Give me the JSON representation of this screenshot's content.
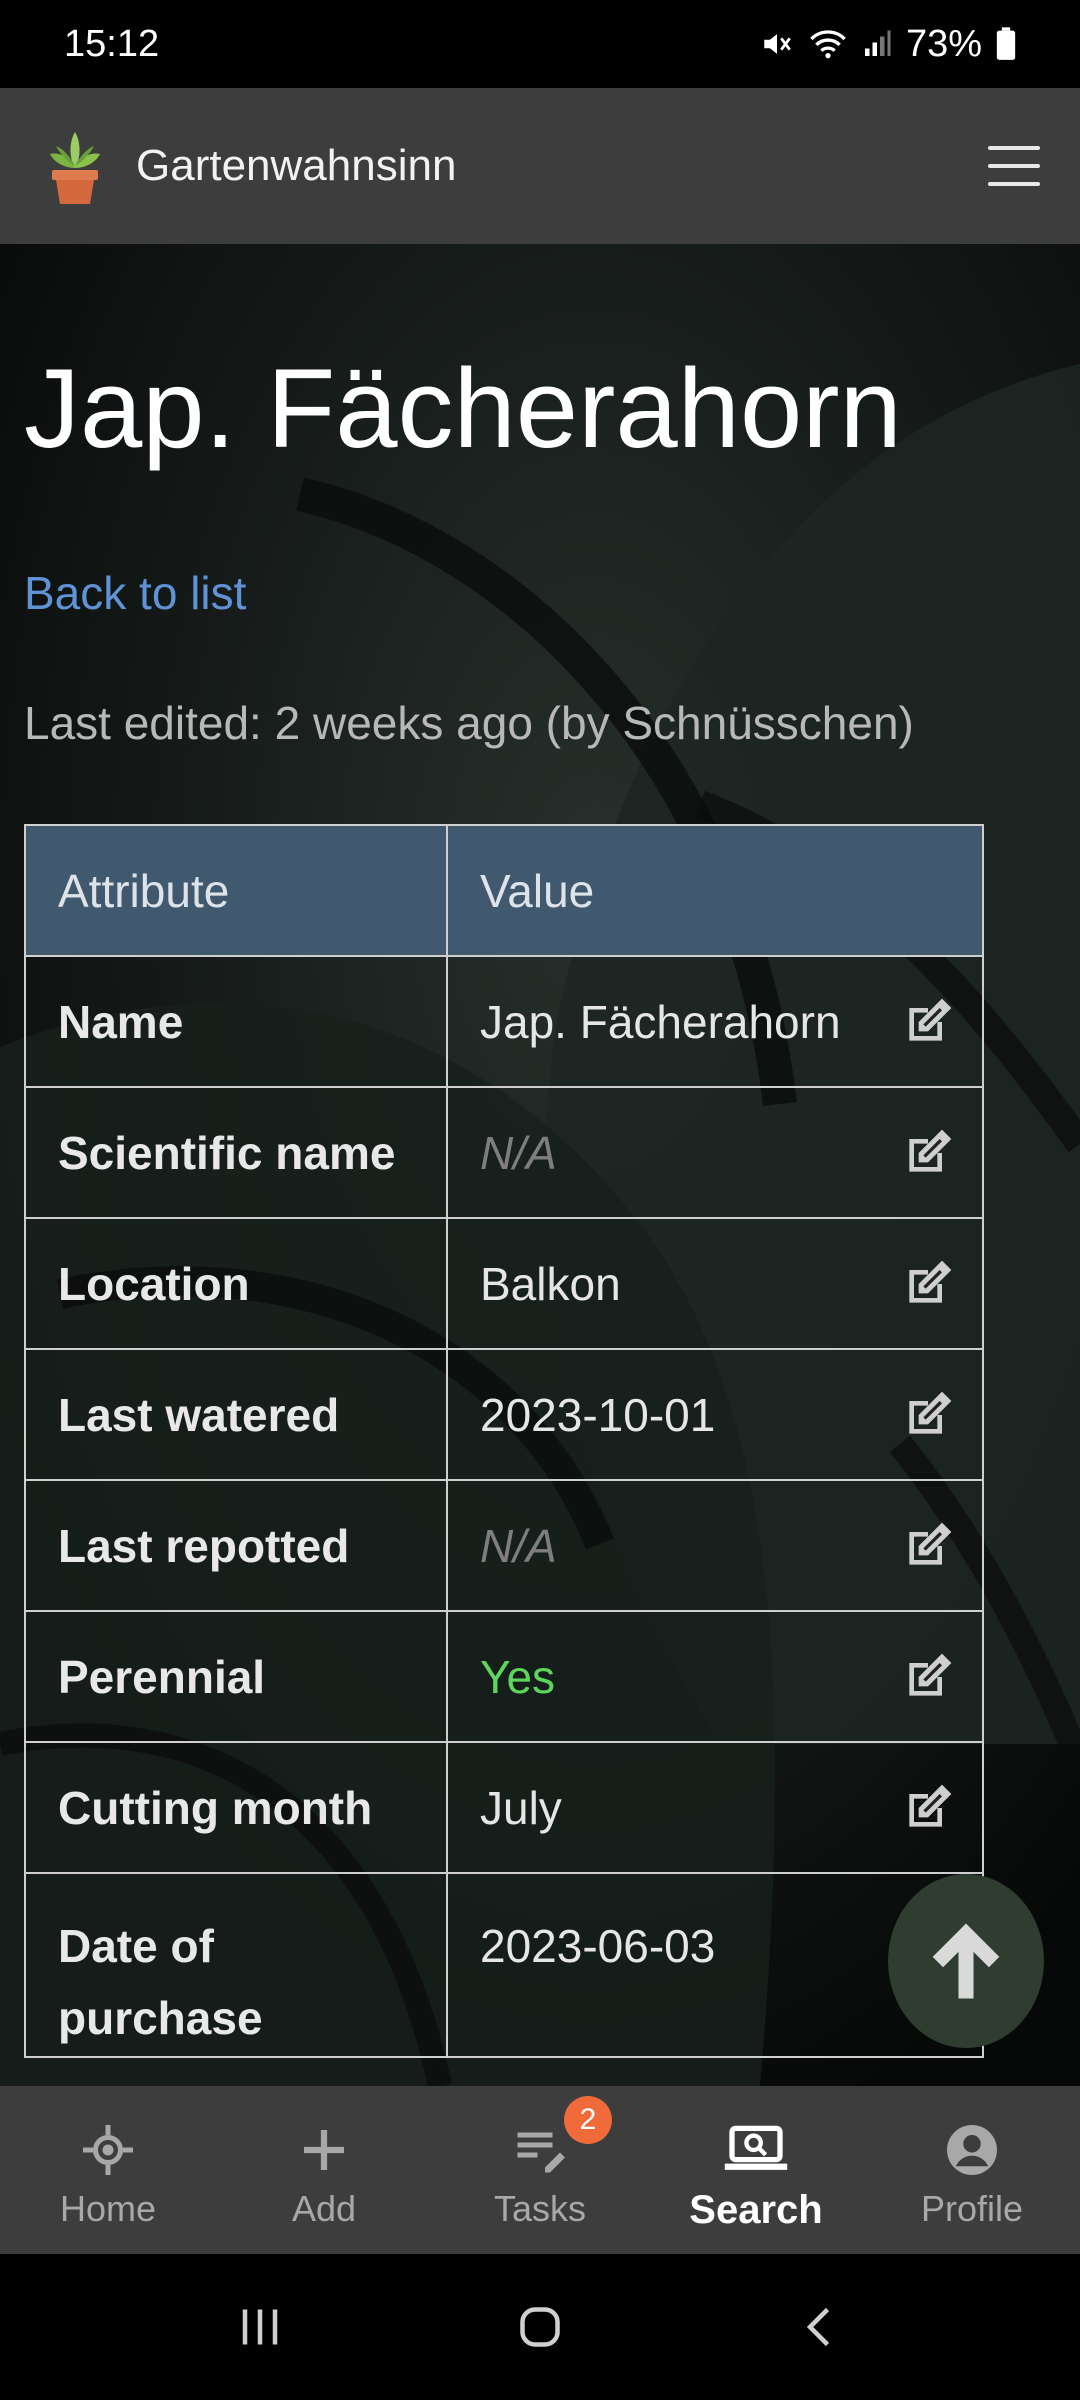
{
  "status_bar": {
    "time": "15:12",
    "battery": "73%",
    "icons": [
      "mute-icon",
      "wifi-icon",
      "signal-icon",
      "battery-icon"
    ]
  },
  "app_bar": {
    "title": "Gartenwahnsinn",
    "logo_icon": "plant-pot-icon",
    "menu_icon": "hamburger-icon"
  },
  "page": {
    "title": "Jap. Fächerahorn",
    "back_link": "Back to list",
    "last_edited": "Last edited: 2 weeks ago (by Schnüsschen)"
  },
  "table": {
    "headers": [
      "Attribute",
      "Value"
    ],
    "rows": [
      {
        "key": "Name",
        "value": "Jap. Fächerahorn"
      },
      {
        "key": "Scientific name",
        "value": "N/A"
      },
      {
        "key": "Location",
        "value": "Balkon"
      },
      {
        "key": "Last watered",
        "value": "2023-10-01"
      },
      {
        "key": "Last repotted",
        "value": "N/A"
      },
      {
        "key": "Perennial",
        "value": "Yes"
      },
      {
        "key": "Cutting month",
        "value": "July"
      },
      {
        "key": "Date of purchase",
        "value": "2023-06-03"
      }
    ]
  },
  "bottom_nav": {
    "items": [
      {
        "label": "Home",
        "icon": "home-icon"
      },
      {
        "label": "Add",
        "icon": "plus-icon"
      },
      {
        "label": "Tasks",
        "icon": "tasks-icon",
        "badge": "2"
      },
      {
        "label": "Search",
        "icon": "search-laptop-icon",
        "active": true
      },
      {
        "label": "Profile",
        "icon": "profile-icon"
      }
    ]
  },
  "colors": {
    "accent_link": "#5f93d6",
    "header_cell": "#41596f",
    "yes_green": "#5cd65c",
    "badge": "#f06a3a",
    "fab": "#2e3d30"
  }
}
